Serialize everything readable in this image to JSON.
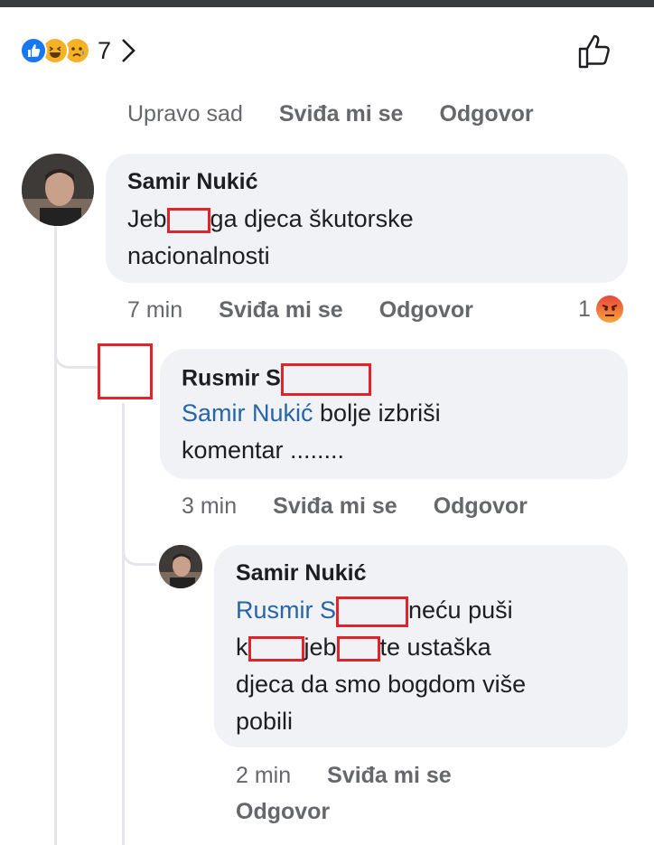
{
  "reactions": {
    "count": "7",
    "icons": [
      "like-icon",
      "haha-icon",
      "sad-icon"
    ]
  },
  "top_meta": {
    "time": "Upravo sad",
    "like": "Sviđa mi se",
    "reply": "Odgovor"
  },
  "comment1": {
    "author": "Samir Nukić",
    "text_part1": "Jeb",
    "text_part2": "ga djeca škutorske",
    "text_line2": "nacionalnosti",
    "time": "7 min",
    "like": "Sviđa mi se",
    "reply": "Odgovor",
    "reaction_count": "1",
    "reaction_icon": "angry-icon"
  },
  "reply1": {
    "author": "Rusmir S",
    "mention": "Samir Nukić",
    "text_line1_rest": " bolje izbriši",
    "text_line2": "komentar ........",
    "time": "3 min",
    "like": "Sviđa mi se",
    "reply": "Odgovor"
  },
  "reply2": {
    "author": "Samir Nukić",
    "mention": "Rusmir S",
    "line1_rest": "neću puši",
    "line2_a": "k",
    "line2_b": "jeb",
    "line2_c": "te ustaška",
    "line3": "djeca da smo bogdom više",
    "line4": "pobili",
    "time": "2 min",
    "like": "Sviđa mi se",
    "reply": "Odgovor"
  },
  "colors": {
    "bubble": "#f0f2f5",
    "meta_text": "#65676b",
    "mention": "#2565a8",
    "redaction": "#e0242b",
    "like_blue": "#1877f2"
  }
}
